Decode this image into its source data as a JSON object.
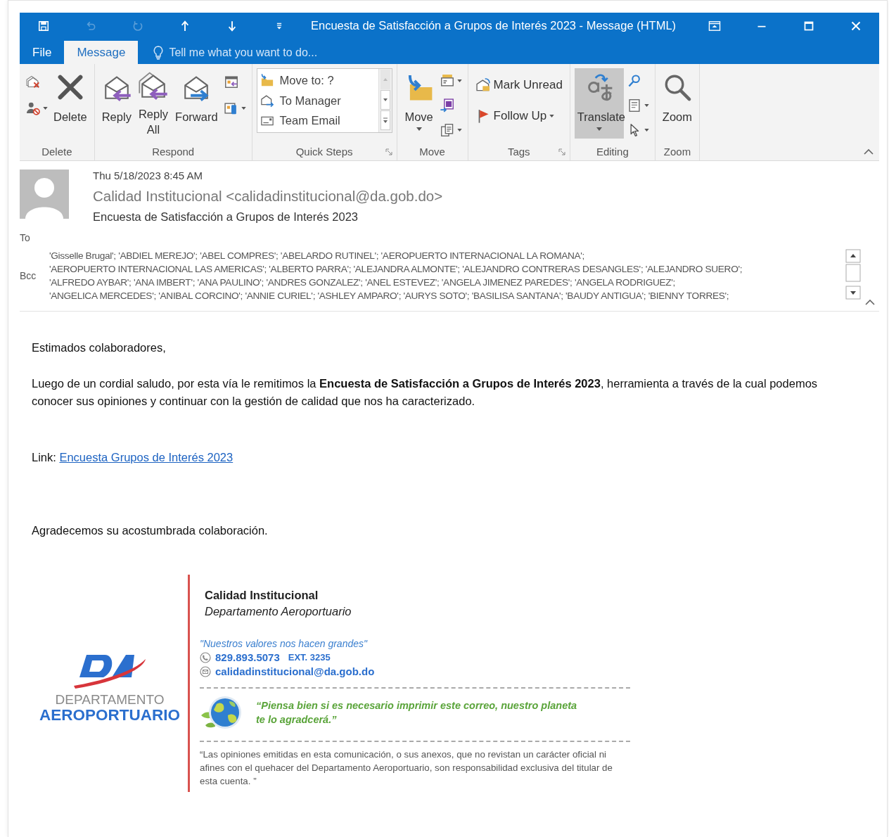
{
  "window": {
    "title": "Encuesta de Satisfacción a Grupos de Interés 2023 - Message (HTML)"
  },
  "quick_access": [
    {
      "kind": "save",
      "disabled": false
    },
    {
      "kind": "undo",
      "disabled": true
    },
    {
      "kind": "redo",
      "disabled": true
    },
    {
      "kind": "up",
      "disabled": false
    },
    {
      "kind": "down",
      "disabled": false
    },
    {
      "kind": "customize",
      "disabled": false
    }
  ],
  "window_controls": [
    {
      "kind": "ribbon_display"
    },
    {
      "kind": "minimize"
    },
    {
      "kind": "maximize"
    },
    {
      "kind": "close"
    }
  ],
  "tabs": [
    {
      "label": "File",
      "selected": false
    },
    {
      "label": "Message",
      "selected": true
    }
  ],
  "tell_me": {
    "placeholder": "Tell me what you want to do..."
  },
  "ribbon": {
    "groups": [
      {
        "label": "Delete",
        "launcher": false,
        "columns": [
          {
            "buttons": [
              {
                "kind": "ignore",
                "dropdown": false,
                "highlighted": false
              },
              {
                "kind": "junk",
                "dropdown": true,
                "highlighted": false
              }
            ]
          },
          {
            "buttons": [
              {
                "kind": "delete",
                "label": "Delete",
                "dropdown": false,
                "highlighted": false
              }
            ]
          }
        ]
      },
      {
        "label": "Respond",
        "launcher": false,
        "columns": [
          {
            "buttons": [
              {
                "kind": "reply",
                "label": "Reply",
                "dropdown": false,
                "highlighted": false
              }
            ]
          },
          {
            "buttons": [
              {
                "kind": "reply_all",
                "label": "Reply All",
                "dropdown": false,
                "highlighted": false
              }
            ]
          },
          {
            "buttons": [
              {
                "kind": "forward",
                "label": "Forward",
                "dropdown": false,
                "highlighted": false
              }
            ]
          },
          {
            "buttons": [
              {
                "kind": "meeting",
                "dropdown": false,
                "highlighted": false
              },
              {
                "kind": "more",
                "dropdown": true,
                "highlighted": false
              }
            ]
          }
        ]
      },
      {
        "label": "Quick Steps",
        "launcher": true,
        "columns": [
          {
            "gallery": [
              {
                "kind": "move_to",
                "label": "Move to: ?"
              },
              {
                "kind": "to_manager",
                "label": "To Manager"
              },
              {
                "kind": "team_email",
                "label": "Team Email"
              }
            ]
          }
        ]
      },
      {
        "label": "Move",
        "launcher": false,
        "columns": [
          {
            "buttons": [
              {
                "kind": "move",
                "label": "Move",
                "dropdown": true,
                "highlighted": false
              }
            ]
          },
          {
            "buttons": [
              {
                "kind": "rules",
                "dropdown": true,
                "highlighted": false
              },
              {
                "kind": "onenote",
                "dropdown": false,
                "highlighted": false
              },
              {
                "kind": "actions",
                "dropdown": true,
                "highlighted": false
              }
            ]
          }
        ]
      },
      {
        "label": "Tags",
        "launcher": true,
        "columns": [
          {
            "buttons": [
              {
                "kind": "mark_unread",
                "label": "Mark Unread",
                "dropdown": false,
                "highlighted": false
              },
              {
                "kind": "follow_up",
                "label": "Follow Up",
                "dropdown": true,
                "highlighted": false
              }
            ]
          }
        ]
      },
      {
        "label": "Editing",
        "launcher": false,
        "columns": [
          {
            "buttons": [
              {
                "kind": "translate",
                "label": "Translate",
                "dropdown": true,
                "highlighted": true
              }
            ]
          },
          {
            "buttons": [
              {
                "kind": "find",
                "dropdown": false,
                "highlighted": false
              },
              {
                "kind": "related",
                "dropdown": true,
                "highlighted": false
              },
              {
                "kind": "select",
                "dropdown": true,
                "highlighted": false
              }
            ]
          }
        ]
      },
      {
        "label": "Zoom",
        "launcher": false,
        "columns": [
          {
            "buttons": [
              {
                "kind": "zoom",
                "label": "Zoom",
                "dropdown": false,
                "highlighted": false
              }
            ]
          }
        ]
      }
    ]
  },
  "header": {
    "date": "Thu 5/18/2023 8:45 AM",
    "from": "Calidad Institucional <calidadinstitucional@da.gob.do>",
    "subject": "Encuesta de Satisfacción a Grupos de Interés 2023",
    "to_label": "To",
    "bcc_label": "Bcc",
    "bcc_lines": [
      "'Gisselle Brugal'; 'ABDIEL MEREJO'; 'ABEL COMPRES'; 'ABELARDO RUTINEL'; 'AEROPUERTO INTERNACIONAL LA ROMANA';",
      "'AEROPUERTO INTERNACIONAL LAS AMERICAS'; 'ALBERTO PARRA'; 'ALEJANDRA ALMONTE'; 'ALEJANDRO CONTRERAS DESANGLES'; 'ALEJANDRO SUERO';",
      "'ALFREDO AYBAR'; 'ANA IMBERT'; 'ANA PAULINO'; 'ANDRES GONZALEZ'; 'ANEL ESTEVEZ'; 'ANGELA JIMENEZ PAREDES'; 'ANGELA RODRIGUEZ';",
      "'ANGELICA MERCEDES'; 'ANIBAL CORCINO'; 'ANNIE CURIEL'; 'ASHLEY AMPARO'; 'AURYS SOTO'; 'BASILISA SANTANA'; 'BAUDY ANTIGUA'; 'BIENNY TORRES';"
    ]
  },
  "body": {
    "greeting": "Estimados colaboradores,",
    "paragraph": "Luego de un cordial saludo, por esta vía le remitimos la **Encuesta de Satisfacción a Grupos de Interés 2023**, herramienta a través de la cual podemos conocer sus opiniones y continuar con la gestión de calidad que nos ha caracterizado.",
    "link_label": "Link:",
    "link": "Encuesta Grupos de Interés 2023",
    "closing": "Agradecemos su acostumbrada colaboración."
  },
  "signature": {
    "logo_line_1": "DEPARTAMENTO",
    "logo_line_2": "AEROPORTUARIO",
    "name": "Calidad Institucional",
    "department": "Departamento Aeroportuario",
    "motto": "\"Nuestros valores nos hacen grandes\"",
    "phone": "829.893.5073",
    "extension": "EXT. 3235",
    "email": "calidadinstitucional@da.gob.do",
    "eco_note": "“Piensa bien si es necesario imprimir este correo, nuestro planeta te lo agradcerá.”",
    "disclaimer": "“Las opiniones emitidas en esta comunicación, o sus anexos, que no revistan un carácter oficial ni afines con el quehacer del Departamento Aeroportuario, son responsabilidad exclusiva del titular de esta cuenta. ”"
  }
}
